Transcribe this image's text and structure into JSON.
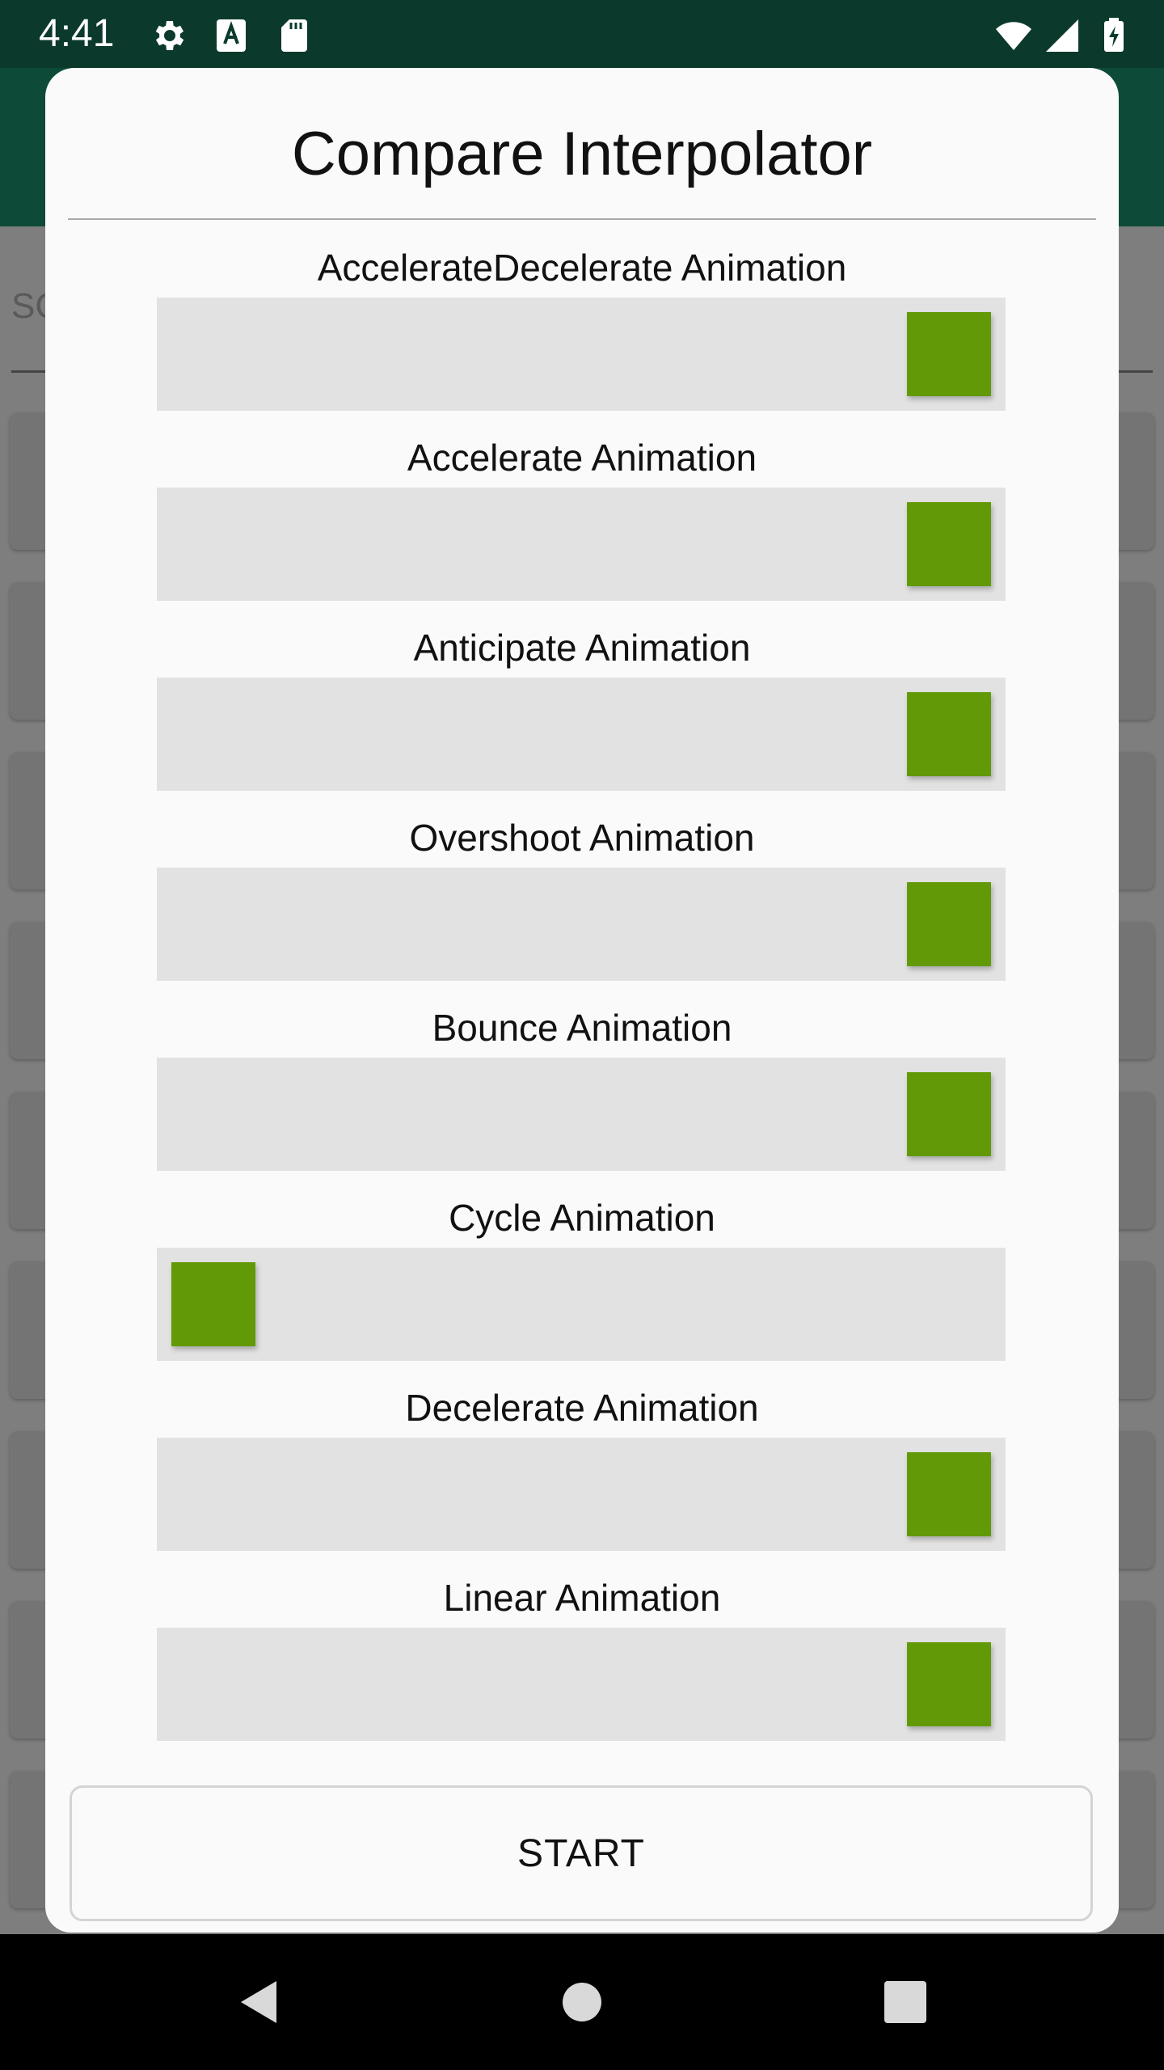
{
  "status_bar": {
    "time": "4:41",
    "left_icons": [
      "gear-icon",
      "a-icon",
      "sd-card-icon"
    ],
    "right_icons": [
      "wifi-icon",
      "signal-icon",
      "battery-charging-icon"
    ]
  },
  "background_app": {
    "search_hint": "SC"
  },
  "dialog": {
    "title": "Compare Interpolator",
    "start_label": "START",
    "animations": [
      {
        "label": "AccelerateDecelerate Animation",
        "progress": 1
      },
      {
        "label": "Accelerate Animation",
        "progress": 1
      },
      {
        "label": "Anticipate Animation",
        "progress": 1
      },
      {
        "label": "Overshoot Animation",
        "progress": 1
      },
      {
        "label": "Bounce Animation",
        "progress": 1
      },
      {
        "label": "Cycle Animation",
        "progress": 0
      },
      {
        "label": "Decelerate Animation",
        "progress": 1
      },
      {
        "label": "Linear Animation",
        "progress": 1
      }
    ]
  },
  "nav_bar": {
    "buttons": [
      "back-icon",
      "home-icon",
      "recents-icon"
    ]
  },
  "colors": {
    "status_bar": "#0b3a2c",
    "box": "#619a06",
    "track": "#e2e2e2",
    "dialog": "#fafafa"
  }
}
